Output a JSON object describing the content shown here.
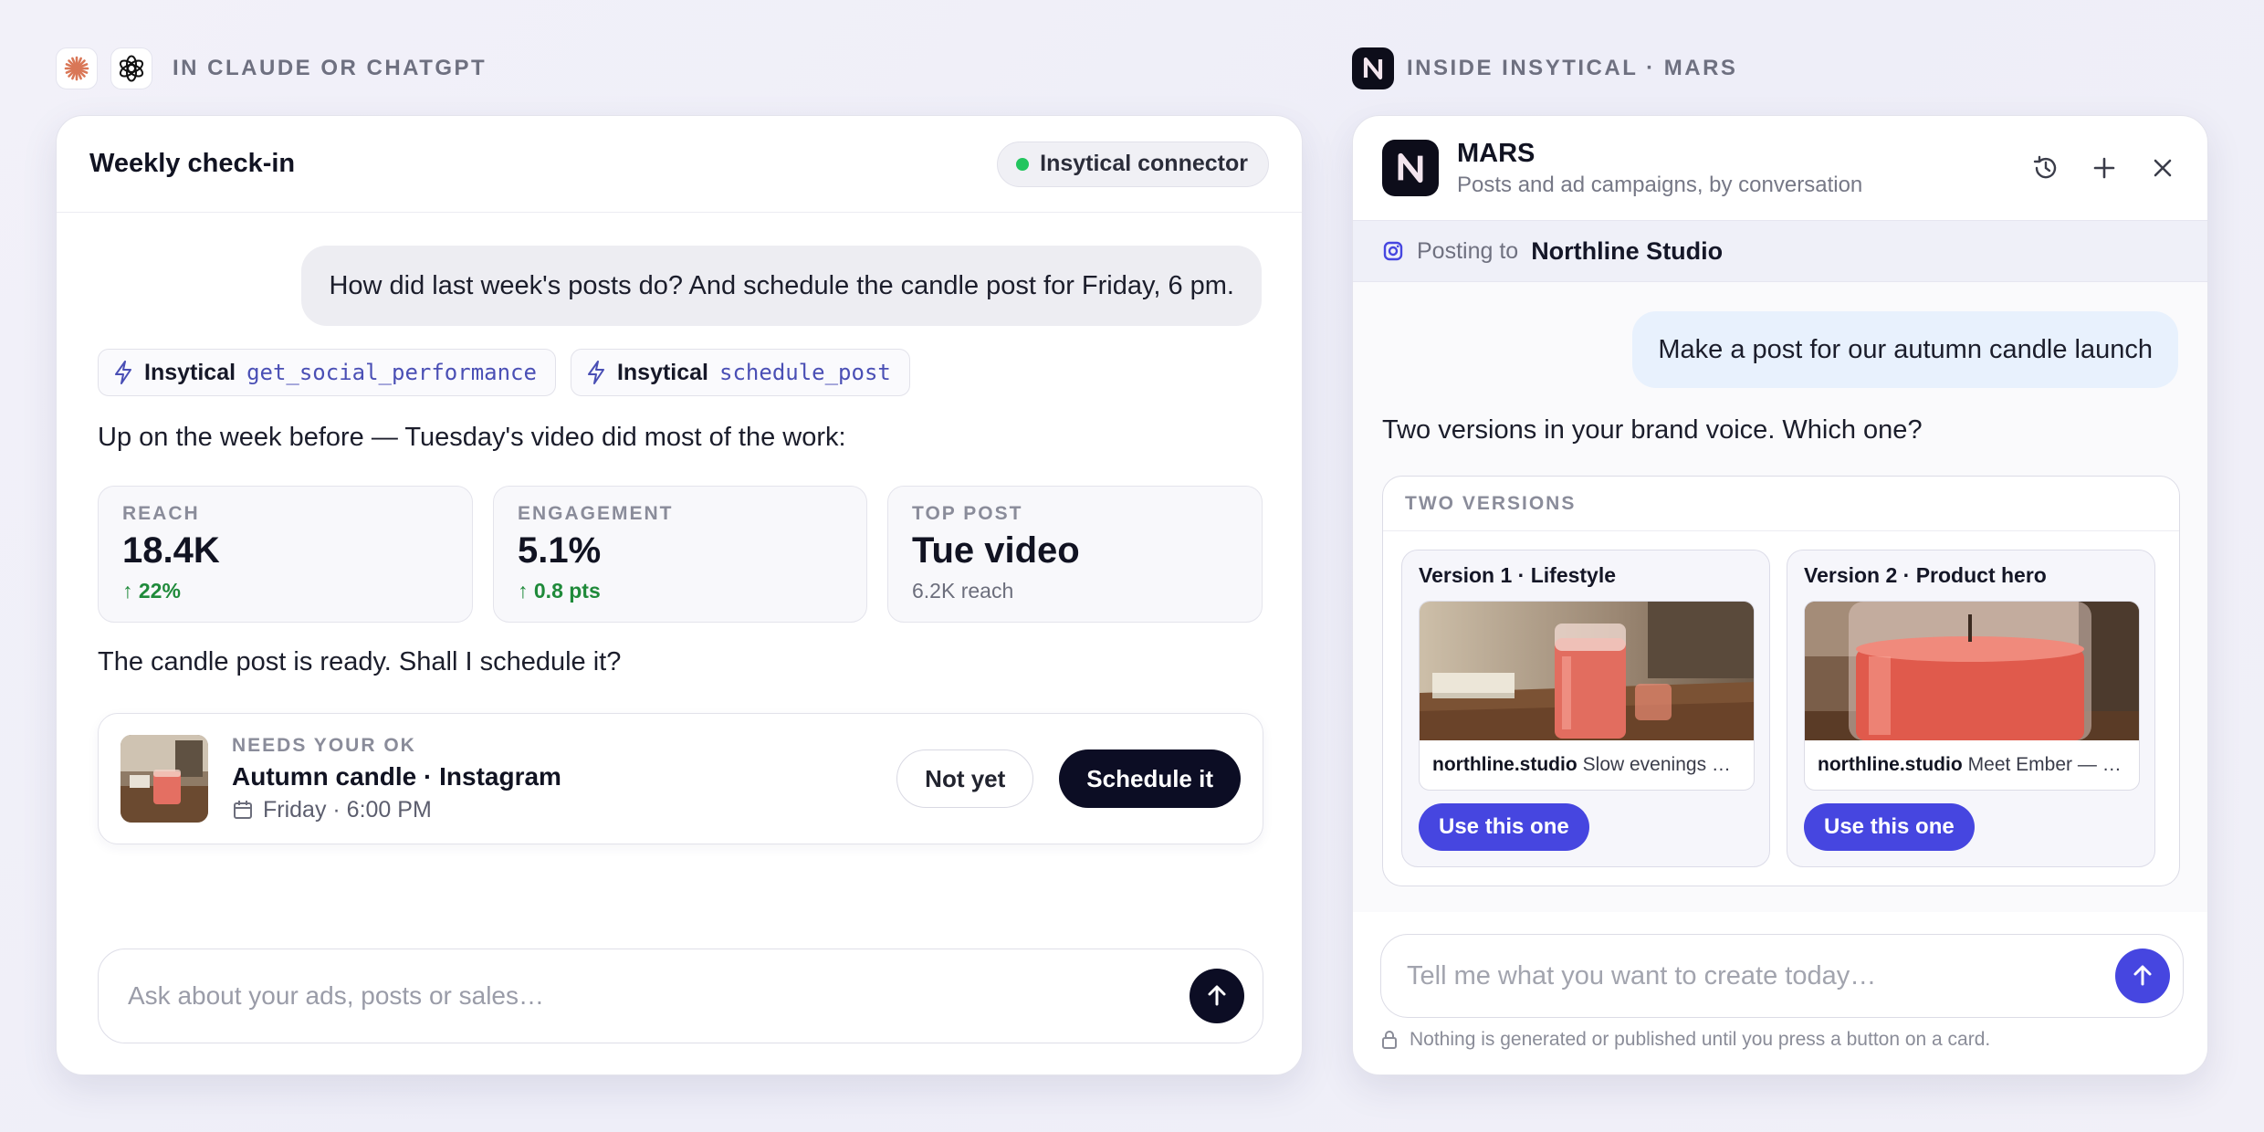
{
  "left_header": {
    "label": "IN CLAUDE OR CHATGPT"
  },
  "right_header": {
    "label": "INSIDE INSYTICAL · MARS"
  },
  "left_panel": {
    "title": "Weekly check-in",
    "connector": "Insytical connector",
    "user_message": "How did last week's posts do? And schedule the candle post for Friday, 6 pm.",
    "tools": [
      {
        "vendor": "Insytical",
        "name": "get_social_performance"
      },
      {
        "vendor": "Insytical",
        "name": "schedule_post"
      }
    ],
    "summary": "Up on the week before — Tuesday's video did most of the work:",
    "stats": [
      {
        "label": "REACH",
        "value": "18.4K",
        "sub": "↑ 22%"
      },
      {
        "label": "ENGAGEMENT",
        "value": "5.1%",
        "sub": "↑ 0.8 pts"
      },
      {
        "label": "TOP POST",
        "value": "Tue video",
        "sub": "6.2K reach"
      }
    ],
    "ready_text": "The candle post is ready. Shall I schedule it?",
    "schedule_card": {
      "kicker": "NEEDS YOUR OK",
      "title": "Autumn candle · Instagram",
      "time": "Friday · 6:00 PM",
      "secondary_button": "Not yet",
      "primary_button": "Schedule it"
    },
    "input": {
      "placeholder": "Ask about your ads, posts or sales…"
    }
  },
  "right_panel": {
    "app_name": "MARS",
    "subtitle": "Posts and ad campaigns, by conversation",
    "posting_label": "Posting to",
    "account": "Northline Studio",
    "user_message": "Make a post for our autumn candle launch",
    "assistant_text": "Two versions in your brand voice. Which one?",
    "versions_header": "TWO VERSIONS",
    "versions": [
      {
        "title": "Version 1 · Lifestyle",
        "handle": "northline.studio",
        "caption": "Slow evenings …",
        "button": "Use this one"
      },
      {
        "title": "Version 2 · Product hero",
        "handle": "northline.studio",
        "caption": "Meet Ember — …",
        "button": "Use this one"
      }
    ],
    "input": {
      "placeholder": "Tell me what you want to create today…"
    },
    "footer": "Nothing is generated or published until you press a button on a card."
  },
  "colors": {
    "accent": "#4646e0",
    "dark": "#0c0d24",
    "success": "#22c55e",
    "positive_text": "#1f8a3a"
  },
  "icons": [
    "claude-icon",
    "chatgpt-icon",
    "insytical-logo-icon",
    "lightning-icon",
    "calendar-icon",
    "arrow-up-icon",
    "history-icon",
    "plus-icon",
    "close-icon",
    "instagram-icon",
    "lock-icon"
  ]
}
